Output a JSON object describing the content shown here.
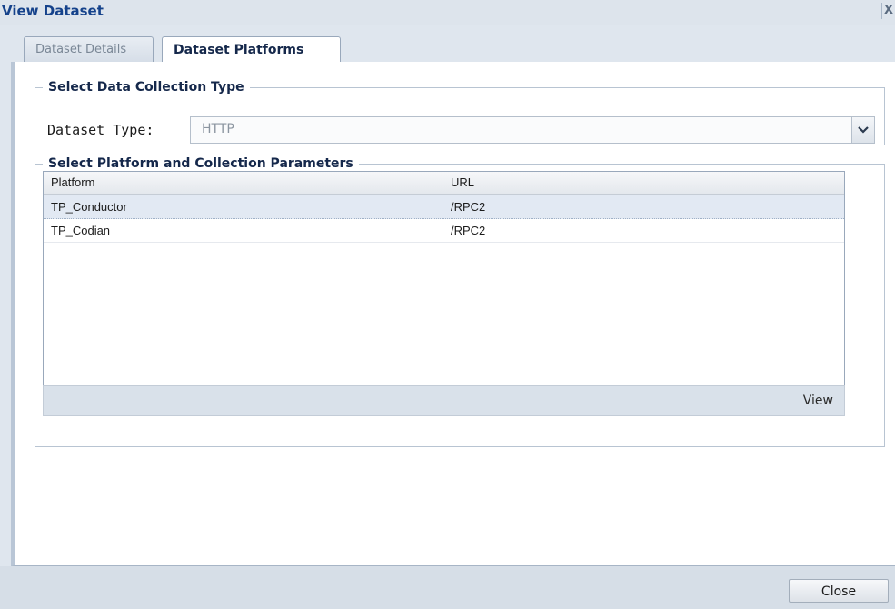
{
  "window": {
    "title": "View Dataset",
    "close_glyph": "X"
  },
  "tabs": [
    {
      "label": "Dataset Details",
      "active": false
    },
    {
      "label": "Dataset Platforms",
      "active": true
    }
  ],
  "collection_type": {
    "legend": "Select Data Collection Type",
    "field_label": "Dataset Type:",
    "value": "HTTP",
    "trigger_icon": "chevron-down-icon"
  },
  "platforms": {
    "legend": "Select Platform and Collection Parameters",
    "columns": [
      "Platform",
      "URL"
    ],
    "rows": [
      {
        "platform": "TP_Conductor",
        "url": "/RPC2",
        "selected": true
      },
      {
        "platform": "TP_Codian",
        "url": "/RPC2",
        "selected": false
      }
    ],
    "view_label": "View"
  },
  "footer": {
    "close_label": "Close"
  },
  "colors": {
    "title": "#15428b",
    "selected_row": "#e2e9f3",
    "panel_bg": "#dfe6ee"
  }
}
